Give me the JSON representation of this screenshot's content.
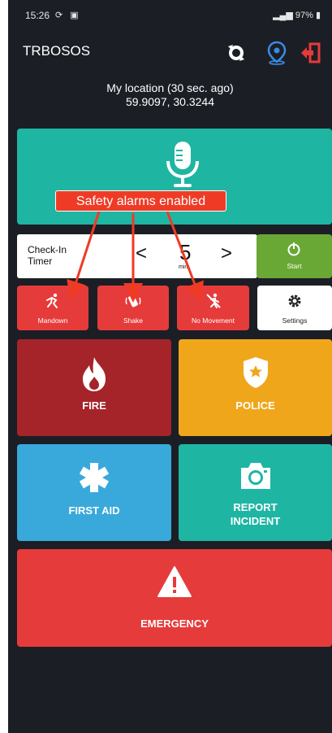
{
  "status_bar": {
    "time": "15:26",
    "left_icons": "sync-icon image-icon",
    "right_text": "97%"
  },
  "app_bar": {
    "title": "TRBOSOS"
  },
  "location": {
    "line1": "My location (30 sec. ago)",
    "line2": "59.9097, 30.3244"
  },
  "annotation": {
    "text": "Safety alarms enabled"
  },
  "timer": {
    "label_line1": "Check-In",
    "label_line2": "Timer",
    "value": "5",
    "unit": "min",
    "prev": "<",
    "next": ">"
  },
  "start": {
    "label": "Start"
  },
  "alarms": [
    {
      "label": "Mandown"
    },
    {
      "label": "Shake"
    },
    {
      "label": "No Movement"
    }
  ],
  "settings": {
    "label": "Settings"
  },
  "tiles": {
    "fire": "FIRE",
    "police": "POLICE",
    "first_aid": "FIRST AID",
    "report_line1": "REPORT",
    "report_line2": "INCIDENT",
    "emergency": "EMERGENCY"
  },
  "colors": {
    "background": "#1b1f25",
    "voice": "#1fb5a3",
    "alarm_red": "#e63b3b",
    "start_green": "#6aa836",
    "fire": "#a5242a",
    "police": "#f0a61a",
    "first_aid": "#39a9db",
    "report": "#1fb5a3",
    "emergency": "#e63b3b",
    "annotation": "#ef3b26"
  }
}
